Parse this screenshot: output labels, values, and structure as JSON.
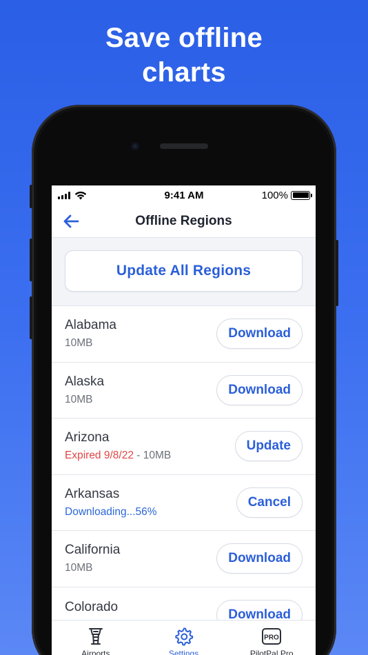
{
  "headline": {
    "line1": "Save offline",
    "line2": "charts"
  },
  "status_bar": {
    "time": "9:41 AM",
    "battery": "100%"
  },
  "nav": {
    "title": "Offline Regions",
    "back_icon": "arrow-left-icon"
  },
  "update_all_label": "Update All Regions",
  "regions": [
    {
      "name": "Alabama",
      "size": "10MB",
      "action": "Download"
    },
    {
      "name": "Alaska",
      "size": "10MB",
      "action": "Download"
    },
    {
      "name": "Arizona",
      "expired": "Expired 9/8/22",
      "sep": " - ",
      "size": "10MB",
      "action": "Update"
    },
    {
      "name": "Arkansas",
      "status": "Downloading...56%",
      "action": "Cancel"
    },
    {
      "name": "California",
      "size": "10MB",
      "action": "Download"
    },
    {
      "name": "Colorado",
      "action": "Download"
    }
  ],
  "tabs": [
    {
      "label": "Airports",
      "icon": "airport-tower-icon"
    },
    {
      "label": "Settings",
      "icon": "gear-icon"
    },
    {
      "label": "PilotPal Pro",
      "icon": "pro-badge-icon",
      "badge_text": "PRO"
    }
  ],
  "colors": {
    "accent": "#2b5fd9",
    "expired": "#e04646",
    "background_top": "#2a5fe6",
    "background_bottom": "#5b88f5"
  }
}
